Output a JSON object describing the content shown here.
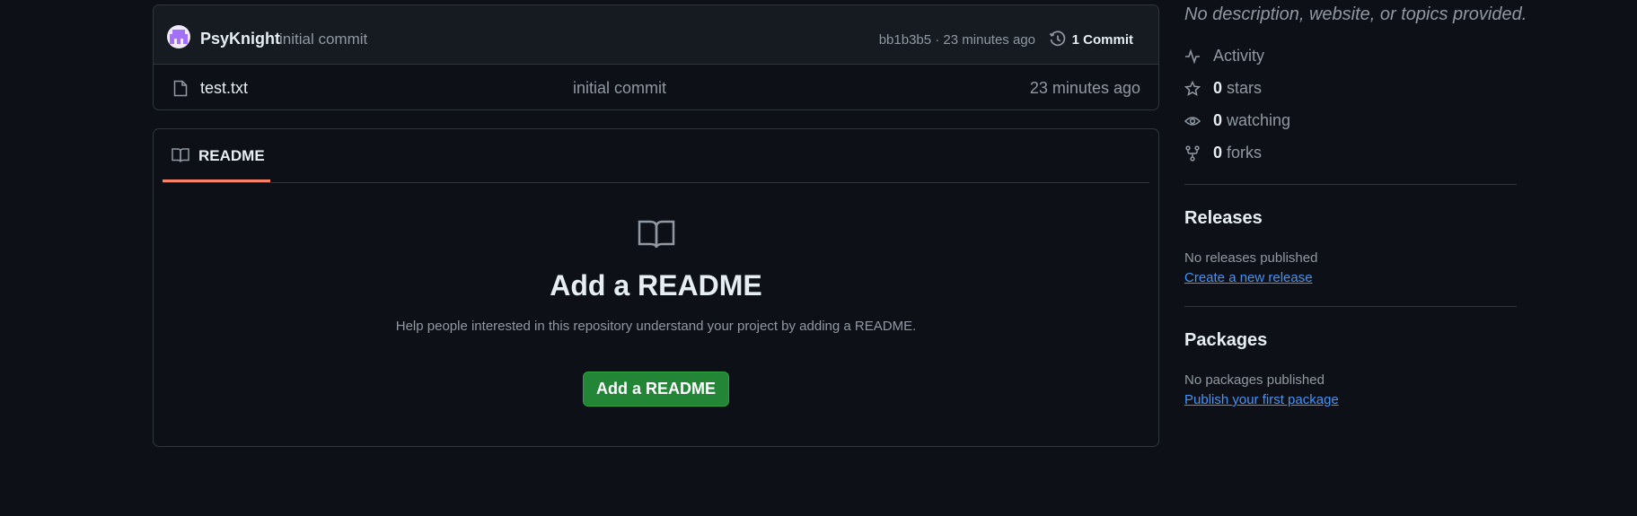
{
  "commit": {
    "author": "PsyKnight",
    "message": "initial commit",
    "meta": "bb1b3b5 · 23 minutes ago",
    "commits_label": "1 Commit"
  },
  "files": [
    {
      "name": "test.txt",
      "last_commit": "initial commit",
      "time": "23 minutes ago"
    }
  ],
  "readme": {
    "tab_label": "README",
    "empty_title": "Add a README",
    "empty_description": "Help people interested in this repository understand your project by adding a README.",
    "button_label": "Add a README"
  },
  "sidebar": {
    "no_description": "No description, website, or topics provided.",
    "activity_label": "Activity",
    "stars": {
      "count": "0",
      "label": "stars"
    },
    "watching": {
      "count": "0",
      "label": "watching"
    },
    "forks": {
      "count": "0",
      "label": "forks"
    },
    "releases": {
      "heading": "Releases",
      "empty": "No releases published",
      "link": "Create a new release"
    },
    "packages": {
      "heading": "Packages",
      "empty": "No packages published",
      "link": "Publish your first package"
    }
  },
  "colors": {
    "background": "#0d1117",
    "border": "#30363d",
    "link": "#4493f8",
    "button_green": "#238636",
    "tab_accent": "#f78166"
  },
  "icons": [
    "history-icon",
    "file-icon",
    "book-icon",
    "pulse-icon",
    "star-icon",
    "eye-icon",
    "fork-icon"
  ]
}
